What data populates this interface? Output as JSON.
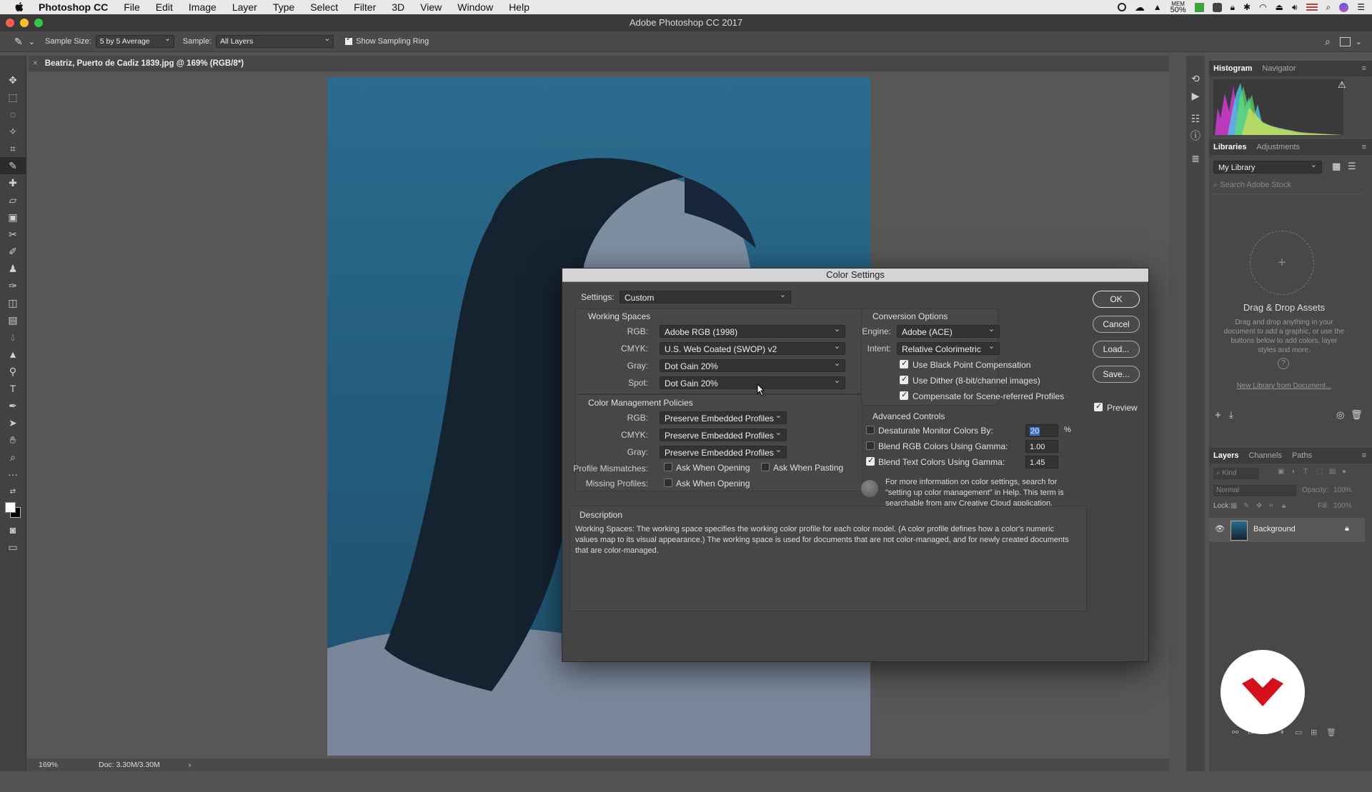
{
  "app": {
    "name": "Photoshop CC",
    "window_title": "Adobe Photoshop CC 2017"
  },
  "menubar": {
    "items": [
      "File",
      "Edit",
      "Image",
      "Layer",
      "Type",
      "Select",
      "Filter",
      "3D",
      "View",
      "Window",
      "Help"
    ],
    "mem": "MEM",
    "mem_pct": "50%"
  },
  "options_bar": {
    "sample_size_label": "Sample Size:",
    "sample_size_value": "5 by 5 Average",
    "sample_label": "Sample:",
    "sample_value": "All Layers",
    "show_ring_label": "Show Sampling Ring",
    "show_ring_checked": true
  },
  "document": {
    "tab_title": "Beatriz, Puerto de Cadiz 1839.jpg @ 169% (RGB/8*)",
    "zoom": "169%",
    "doc_info": "Doc: 3.30M/3.30M"
  },
  "dialog": {
    "title": "Color Settings",
    "settings_label": "Settings:",
    "settings_value": "Custom",
    "working_spaces": {
      "title": "Working Spaces",
      "rgb_label": "RGB:",
      "rgb_value": "Adobe RGB (1998)",
      "cmyk_label": "CMYK:",
      "cmyk_value": "U.S. Web Coated (SWOP) v2",
      "gray_label": "Gray:",
      "gray_value": "Dot Gain 20%",
      "spot_label": "Spot:",
      "spot_value": "Dot Gain 20%"
    },
    "policies": {
      "title": "Color Management Policies",
      "rgb_label": "RGB:",
      "rgb_value": "Preserve Embedded Profiles",
      "cmyk_label": "CMYK:",
      "cmyk_value": "Preserve Embedded Profiles",
      "gray_label": "Gray:",
      "gray_value": "Preserve Embedded Profiles",
      "mismatch_label": "Profile Mismatches:",
      "ask_opening": "Ask When Opening",
      "ask_pasting": "Ask When Pasting",
      "missing_label": "Missing Profiles:",
      "missing_ask_opening": "Ask When Opening"
    },
    "conversion": {
      "title": "Conversion Options",
      "engine_label": "Engine:",
      "engine_value": "Adobe (ACE)",
      "intent_label": "Intent:",
      "intent_value": "Relative Colorimetric",
      "black_point": "Use Black Point Compensation",
      "dither": "Use Dither (8-bit/channel images)",
      "scene": "Compensate for Scene-referred Profiles"
    },
    "advanced": {
      "title": "Advanced Controls",
      "desaturate_label": "Desaturate Monitor Colors By:",
      "desaturate_value": "20",
      "percent": "%",
      "blend_rgb_label": "Blend RGB Colors Using Gamma:",
      "blend_rgb_value": "1.00",
      "blend_text_label": "Blend Text Colors Using Gamma:",
      "blend_text_value": "1.45"
    },
    "info_text": "For more information on color settings, search for \"setting up color management\" in Help. This term is searchable from any Creative Cloud application.",
    "description": {
      "title": "Description",
      "text": "Working Spaces:  The working space specifies the working color profile for each color model.  (A color profile defines how a color's numeric values map to its visual appearance.)  The working space is used for documents that are not color-managed, and for newly created documents that are color-managed."
    },
    "buttons": {
      "ok": "OK",
      "cancel": "Cancel",
      "load": "Load...",
      "save": "Save...",
      "preview": "Preview"
    }
  },
  "panels": {
    "histogram_tab": "Histogram",
    "navigator_tab": "Navigator",
    "libraries_tab": "Libraries",
    "adjustments_tab": "Adjustments",
    "library_name": "My Library",
    "search_placeholder": "Search Adobe Stock",
    "drag_drop_title": "Drag & Drop Assets",
    "drag_drop_text": "Drag and drop anything in your document to add a graphic, or use the buttons below to add colors, layer styles and more.",
    "new_library_link": "New Library from Document...",
    "layers_tab": "Layers",
    "channels_tab": "Channels",
    "paths_tab": "Paths",
    "kind_label": "Kind",
    "blend_mode": "Normal",
    "opacity_label": "Opacity:",
    "opacity_value": "100%",
    "lock_label": "Lock:",
    "fill_label": "Fill:",
    "fill_value": "100%",
    "layer_name": "Background"
  }
}
